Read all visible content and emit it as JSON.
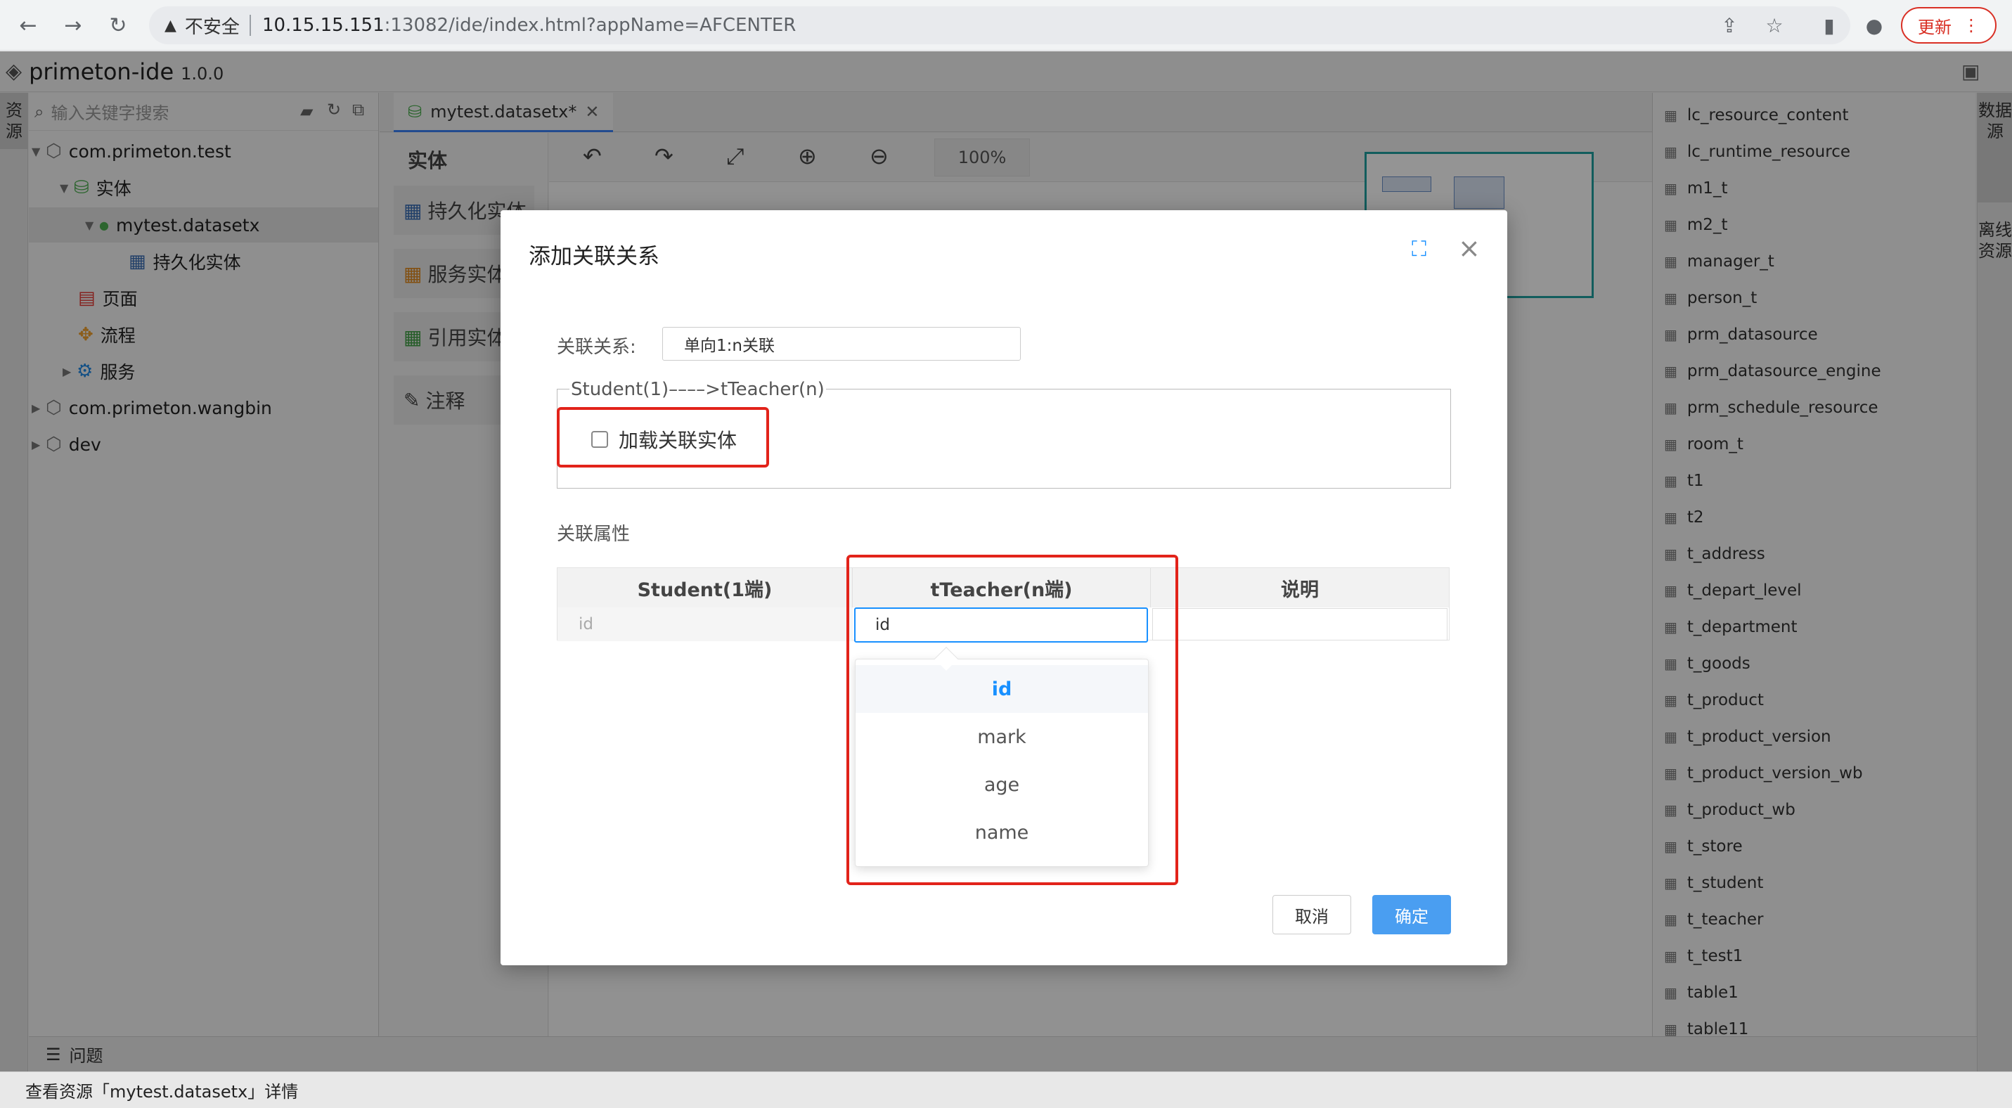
{
  "browser": {
    "security_label": "不安全",
    "url_host": "10.15.15.151",
    "url_rest": ":13082/ide/index.html?appName=AFCENTER",
    "update_label": "更新"
  },
  "ide": {
    "name": "primeton-ide",
    "version": "1.0.0"
  },
  "left_strip": {
    "tab": "资源"
  },
  "tree": {
    "search_placeholder": "输入关键字搜索",
    "items": [
      {
        "label": "com.primeton.test"
      },
      {
        "label": "实体"
      },
      {
        "label": "mytest.datasetx"
      },
      {
        "label": "持久化实体"
      },
      {
        "label": "页面"
      },
      {
        "label": "流程"
      },
      {
        "label": "服务"
      },
      {
        "label": "com.primeton.wangbin"
      },
      {
        "label": "dev"
      }
    ]
  },
  "editor": {
    "tab_label": "mytest.datasetx*",
    "palette_title": "实体",
    "palette_items": [
      "持久化实体",
      "服务实体",
      "引用实体",
      "注释"
    ],
    "zoom": "100%"
  },
  "right_panel": {
    "tables": [
      "lc_resource_content",
      "lc_runtime_resource",
      "m1_t",
      "m2_t",
      "manager_t",
      "person_t",
      "prm_datasource",
      "prm_datasource_engine",
      "prm_schedule_resource",
      "room_t",
      "t1",
      "t2",
      "t_address",
      "t_depart_level",
      "t_department",
      "t_goods",
      "t_product",
      "t_product_version",
      "t_product_version_wb",
      "t_product_wb",
      "t_store",
      "t_student",
      "t_teacher",
      "t_test1",
      "table1",
      "table11"
    ]
  },
  "right_strip": {
    "tab1": "数据源",
    "tab2": "离线资源"
  },
  "bottom": {
    "problems_label": "问题",
    "status_text": "查看资源「mytest.datasetx」详情"
  },
  "dialog": {
    "title": "添加关联关系",
    "relation_label": "关联关系:",
    "relation_value": "单向1:n关联",
    "fieldset_legend": "Student(1)––––>tTeacher(n)",
    "load_checkbox_label": "加载关联实体",
    "load_checkbox_checked": false,
    "props_label": "关联属性",
    "table": {
      "headers": [
        "Student(1端)",
        "tTeacher(n端)",
        "说明"
      ],
      "row": {
        "student": "id",
        "teacher": "id",
        "desc": ""
      }
    },
    "dropdown_options": [
      "id",
      "mark",
      "age",
      "name"
    ],
    "dropdown_selected": "id",
    "cancel_label": "取消",
    "ok_label": "确定"
  },
  "colors": {
    "accent": "#1890ff",
    "ok_button": "#4a9ef1",
    "highlight_red": "#e2231a",
    "update_red": "#d93025"
  }
}
